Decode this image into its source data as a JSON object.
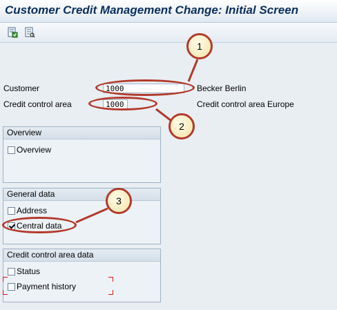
{
  "window": {
    "title": "Customer Credit Management Change: Initial Screen"
  },
  "toolbar": {
    "buttons": [
      {
        "icon": "execute-icon"
      },
      {
        "icon": "display-list-icon"
      }
    ]
  },
  "fields": {
    "customer": {
      "label": "Customer",
      "value": "1000",
      "description": "Becker Berlin"
    },
    "credit_control_area": {
      "label": "Credit control area",
      "value": "1000",
      "description": "Credit control area Europe"
    }
  },
  "groups": {
    "overview": {
      "title": "Overview",
      "items": [
        {
          "label": "Overview",
          "checked": false
        }
      ]
    },
    "general_data": {
      "title": "General data",
      "items": [
        {
          "label": "Address",
          "checked": false
        },
        {
          "label": "Central data",
          "checked": true
        }
      ]
    },
    "credit_area_data": {
      "title": "Credit control area data",
      "items": [
        {
          "label": "Status",
          "checked": false
        },
        {
          "label": "Payment history",
          "checked": false
        }
      ]
    }
  },
  "callouts": {
    "one": "1",
    "two": "2",
    "three": "3"
  },
  "annotation_color": "#b23a2a"
}
